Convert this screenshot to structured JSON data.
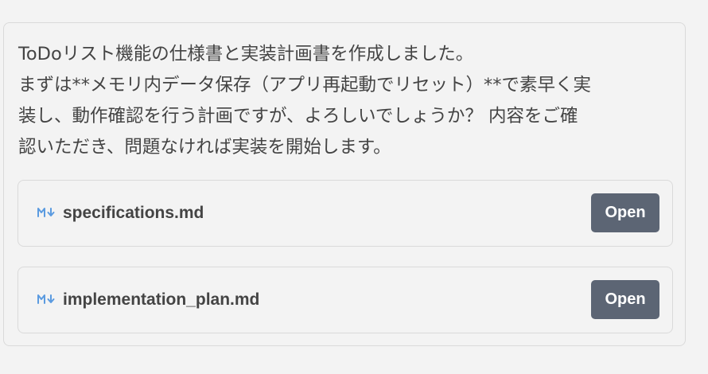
{
  "message": {
    "lines": [
      "ToDoリスト機能の仕様書と実装計画書を作成しました。",
      "まずは**メモリ内データ保存（アプリ再起動でリセット）**で素早く実",
      "装し、動作確認を行う計画ですが、よろしいでしょうか？ 内容をご確",
      "認いただき、問題なければ実装を開始します。"
    ]
  },
  "files": [
    {
      "name": "specifications.md",
      "icon": "markdown-icon",
      "button_label": "Open"
    },
    {
      "name": "implementation_plan.md",
      "icon": "markdown-icon",
      "button_label": "Open"
    }
  ],
  "colors": {
    "background": "#f3f3f3",
    "border": "#dadada",
    "button": "#5c6574",
    "markdown_icon": "#5b9be0"
  }
}
